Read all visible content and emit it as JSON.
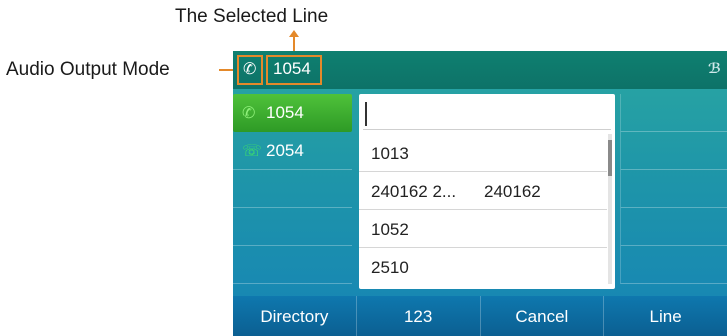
{
  "annotations": {
    "selected_line": "The Selected Line",
    "audio_output_mode": "Audio Output Mode"
  },
  "statusbar": {
    "audio_mode_icon": "handset-icon",
    "selected_line": "1054",
    "bluetooth_icon": "bluetooth-icon"
  },
  "lines": [
    {
      "label": "1054",
      "icon": "handset-icon",
      "state": "active"
    },
    {
      "label": "2054",
      "icon": "phone-icon",
      "state": "idle"
    }
  ],
  "search": {
    "value": ""
  },
  "results": [
    {
      "name": "1013",
      "number": ""
    },
    {
      "name": "240162 2...",
      "number": "240162"
    },
    {
      "name": "1052",
      "number": ""
    },
    {
      "name": "2510",
      "number": ""
    }
  ],
  "softkeys": [
    "Directory",
    "123",
    "Cancel",
    "Line"
  ],
  "colors": {
    "annotation_orange": "#e4892a",
    "active_line_green": "#3aa82c",
    "softkey_blue": "#0d6aa0"
  }
}
